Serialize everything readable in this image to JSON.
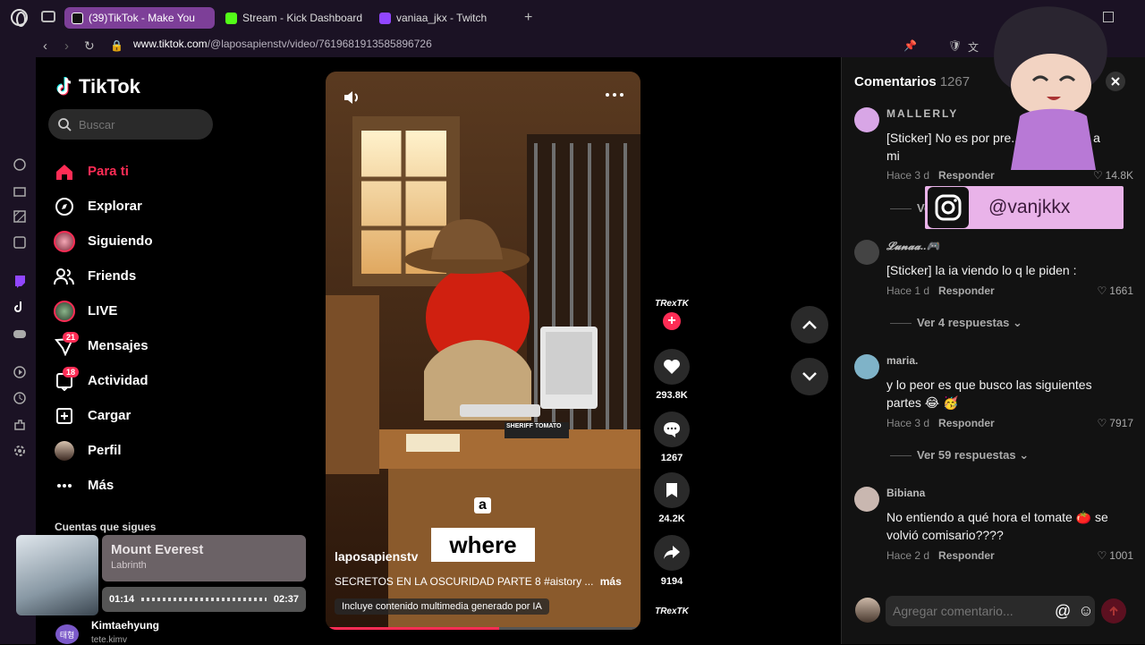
{
  "browser": {
    "tabs": [
      {
        "label": "(39)TikTok - Make You",
        "color": "#e8e8e8",
        "active": true
      },
      {
        "label": "Stream - Kick Dashboard",
        "color": "#53fc18",
        "active": false
      },
      {
        "label": "vaniaa_jkx - Twitch",
        "color": "#9146ff",
        "active": false
      }
    ],
    "url_host": "www.tiktok.com",
    "url_path": "/@laposapienstv/video/7619681913585896726"
  },
  "sidebar": {
    "brand": "TikTok",
    "search_placeholder": "Buscar",
    "items": [
      {
        "label": "Para ti",
        "icon": "home-icon"
      },
      {
        "label": "Explorar",
        "icon": "compass-icon"
      },
      {
        "label": "Siguiendo",
        "icon": "avatar-icon"
      },
      {
        "label": "Friends",
        "icon": "friends-icon"
      },
      {
        "label": "LIVE",
        "icon": "live-icon"
      },
      {
        "label": "Mensajes",
        "icon": "message-icon",
        "badge": "21"
      },
      {
        "label": "Actividad",
        "icon": "inbox-icon",
        "badge": "18"
      },
      {
        "label": "Cargar",
        "icon": "upload-icon"
      },
      {
        "label": "Perfil",
        "icon": "profile-icon"
      },
      {
        "label": "Más",
        "icon": "more-icon"
      }
    ],
    "following_heading": "Cuentas que sigues",
    "following_user": "Kimtaehyung",
    "following_user_sub": "tete.kimv",
    "following_avatar": "태형"
  },
  "music": {
    "title": "Mount Everest",
    "artist": "Labrinth",
    "elapsed": "01:14",
    "total": "02:37"
  },
  "video": {
    "author": "laposapienstv",
    "description": "SECRETOS EN LA OSCURIDAD PARTE 8 #aistory ...",
    "more": "más",
    "ai_label": "Incluye contenido multimedia generado por IA",
    "caption_small": "a",
    "caption_big": "where",
    "sign": "SHERIFF TOMATO",
    "progress": 0.55
  },
  "actions": {
    "likes": "293.8K",
    "comments": "1267",
    "saves": "24.2K",
    "shares": "9194",
    "creator_tag": "TRexTK"
  },
  "comments": {
    "title": "Comentarios",
    "count": "1267",
    "items": [
      {
        "user": "MALLERLY",
        "text": "[Sticker] No es por pre... p8 me llegó a mi",
        "time": "Hace 3 d",
        "reply": "Responder",
        "likes": "14.8K",
        "more": "Ver",
        "avatar": "#d8a6e6"
      },
      {
        "user": "𝓛𝓾𝓷𝓪𝓪..🎮",
        "text": "[Sticker] la ia viendo lo q le piden :",
        "time": "Hace 1 d",
        "reply": "Responder",
        "likes": "1661",
        "more": "Ver 4 respuestas",
        "avatar": "#444"
      },
      {
        "user": "maria.",
        "text": "y lo peor es que busco las siguientes partes 😂 🥳",
        "time": "Hace 3 d",
        "reply": "Responder",
        "likes": "7917",
        "more": "Ver 59 respuestas",
        "avatar": "#7fb3c8"
      },
      {
        "user": "Bibiana",
        "text": "No entiendo a qué hora el tomate 🍅 se volvió comisario????",
        "time": "Hace 2 d",
        "reply": "Responder",
        "likes": "1001",
        "more": "",
        "avatar": "#c9b7b0"
      }
    ],
    "input_placeholder": "Agregar comentario..."
  },
  "overlay": {
    "instagram_handle": "@vanjkkx"
  },
  "colors": {
    "accent": "#fe2c55",
    "chrome": "#1b1224",
    "active_tab": "#7d3f98"
  }
}
